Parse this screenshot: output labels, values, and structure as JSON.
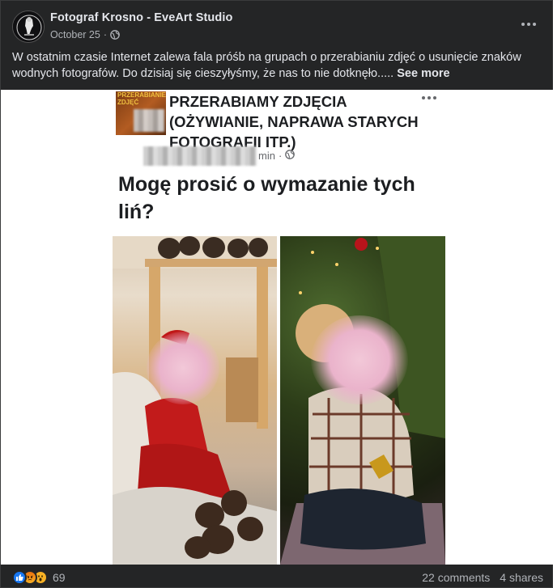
{
  "post": {
    "author": "Fotograf Krosno - EveArt Studio",
    "date": "October 25",
    "date_separator": "·",
    "text": "W ostatnim czasie Internet zalewa fala próśb na grupach o przerabianiu zdjęć o usunięcie znaków wodnych fotografów. Do dzisiaj się cieszyłyśmy, że nas to nie dotknęło.....",
    "see_more": "See more",
    "privacy_icon": "globe-icon",
    "menu_icon": "more-horizontal-icon"
  },
  "shared_image": {
    "group_avatar_text": "PRZERABIANIE\nZDJĘĆ",
    "group_name": "PRZERABIAMY ZDJĘCIA\n(OŻYWIANIE, NAPRAWA STARYCH\nFOTOGRAFII ITP.)",
    "time": "min",
    "time_separator": "·",
    "question": "Mogę prosić o wymazanie tych liń?"
  },
  "footer": {
    "reactions": [
      "like-reaction-icon",
      "angry-reaction-icon",
      "wow-reaction-icon"
    ],
    "reaction_count": "69",
    "comments": "22 comments",
    "shares": "4 shares"
  },
  "colors": {
    "background": "#242526",
    "text_primary": "#e4e6eb",
    "text_secondary": "#b0b3b8",
    "like_blue": "#1877f2",
    "angry_orange": "#e9710f",
    "wow_yellow": "#f7b125"
  }
}
